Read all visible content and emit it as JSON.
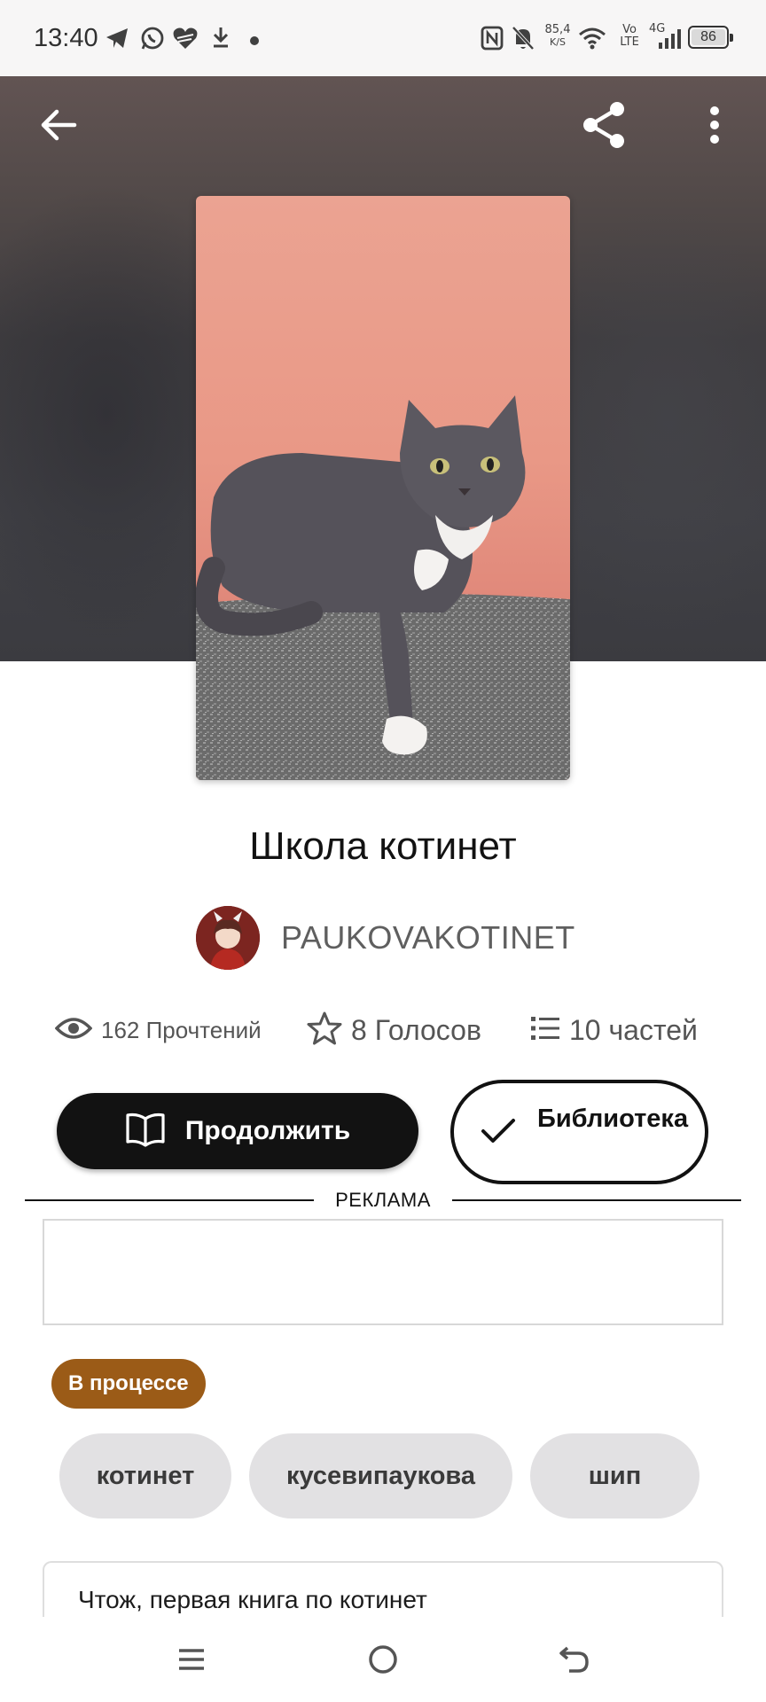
{
  "status_bar": {
    "time": "13:40",
    "net_speed_value": "85,4",
    "net_speed_unit": "K/S",
    "volte_top": "Vo",
    "volte_bottom": "LTE",
    "signal_label": "4G",
    "battery": "86",
    "icons": [
      "telegram-icon",
      "whatsapp-icon",
      "heart-app-icon",
      "download-icon",
      "dot-icon",
      "nfc-icon",
      "bell-muted-icon",
      "wifi-icon",
      "signal-icon",
      "battery-icon"
    ]
  },
  "toolbar": {
    "back_icon": "arrow-left-icon",
    "share_icon": "share-icon",
    "more_icon": "more-vertical-icon"
  },
  "story": {
    "title": "Школа котинет",
    "author": "PAUKOVAKOTINET",
    "stats": {
      "reads": "162 Прочтений",
      "votes": "8 Голосов",
      "parts": "10 частей"
    },
    "continue_label": "Продолжить",
    "library_label": "Библиотека",
    "ad_label": "РЕКЛАМА",
    "status_badge": "В процессе",
    "tags": [
      "котинет",
      "кусевипаукова",
      "шип"
    ],
    "description_first_line": "Чтож, первая книга по котинет"
  },
  "colors": {
    "primary_button": "#121212",
    "badge": "#9b5b17",
    "tag_bg": "#e2e1e3"
  },
  "nav_bar": {
    "icons": [
      "menu-icon",
      "home-circle-icon",
      "back-icon"
    ]
  }
}
